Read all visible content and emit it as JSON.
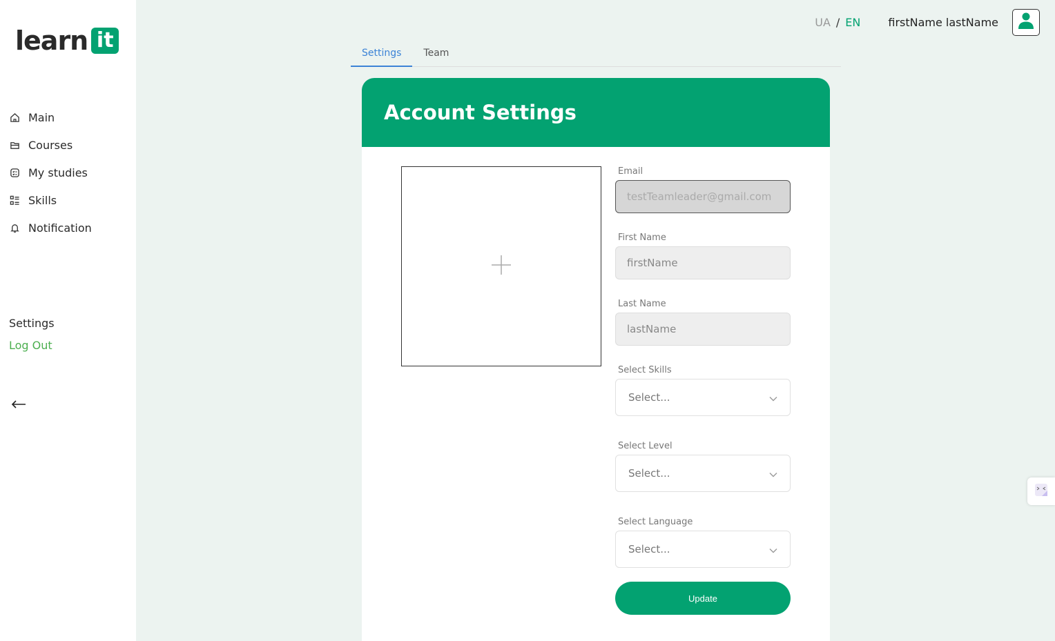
{
  "brand": {
    "logo_text": "learn",
    "logo_badge": "it",
    "accent": "#03a271"
  },
  "sidebar": {
    "items": [
      {
        "label": "Main",
        "icon": "home-icon"
      },
      {
        "label": "Courses",
        "icon": "folder-icon"
      },
      {
        "label": "My studies",
        "icon": "studies-icon"
      },
      {
        "label": "Skills",
        "icon": "list-icon"
      },
      {
        "label": "Notification",
        "icon": "bell-icon"
      }
    ],
    "settings_label": "Settings",
    "logout_label": "Log Out",
    "back_icon": "arrow-left-icon"
  },
  "header": {
    "lang_ua": "UA",
    "lang_sep": "/",
    "lang_en": "EN",
    "username": "firstName lastName",
    "avatar_icon": "user-icon"
  },
  "tabs": [
    {
      "label": "Settings",
      "active": true
    },
    {
      "label": "Team",
      "active": false
    }
  ],
  "card": {
    "title": "Account Settings",
    "upload_icon": "plus-icon"
  },
  "form": {
    "email": {
      "label": "Email",
      "value": "testTeamleader@gmail.com"
    },
    "first_name": {
      "label": "First Name",
      "value": "firstName"
    },
    "last_name": {
      "label": "Last Name",
      "value": "lastName"
    },
    "skills": {
      "label": "Select Skills",
      "value": "Select..."
    },
    "level": {
      "label": "Select Level",
      "value": "Select..."
    },
    "language": {
      "label": "Select Language",
      "value": "Select..."
    },
    "update_label": "Update"
  },
  "widget_icon": "translate-widget-icon"
}
